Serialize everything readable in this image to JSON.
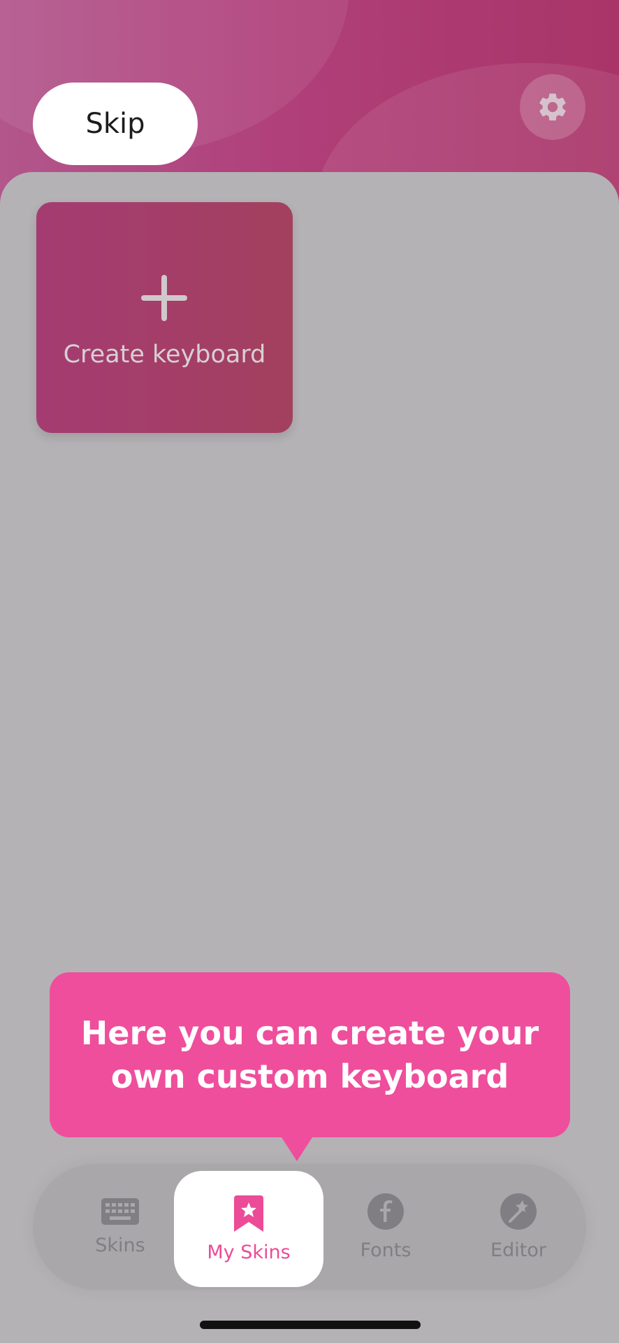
{
  "header": {
    "skip_label": "Skip",
    "settings_icon": "gear-icon"
  },
  "create_card": {
    "icon": "plus-icon",
    "label": "Create keyboard"
  },
  "tooltip": {
    "text": "Here you can create your own custom keyboard"
  },
  "tabbar": {
    "tabs": [
      {
        "label": "Skins",
        "icon": "keyboard-icon",
        "active": false
      },
      {
        "label": "My Skins",
        "icon": "bookmark-star-icon",
        "active": true
      },
      {
        "label": "Fonts",
        "icon": "font-icon",
        "active": false
      },
      {
        "label": "Editor",
        "icon": "magic-wand-icon",
        "active": false
      }
    ]
  },
  "colors": {
    "accent": "#ec4b97",
    "tooltip_bg": "#ef4e9c",
    "header_gradient_start": "#b2568c",
    "header_gradient_end": "#a93568",
    "overlay_bg": "#b4b2b5"
  }
}
